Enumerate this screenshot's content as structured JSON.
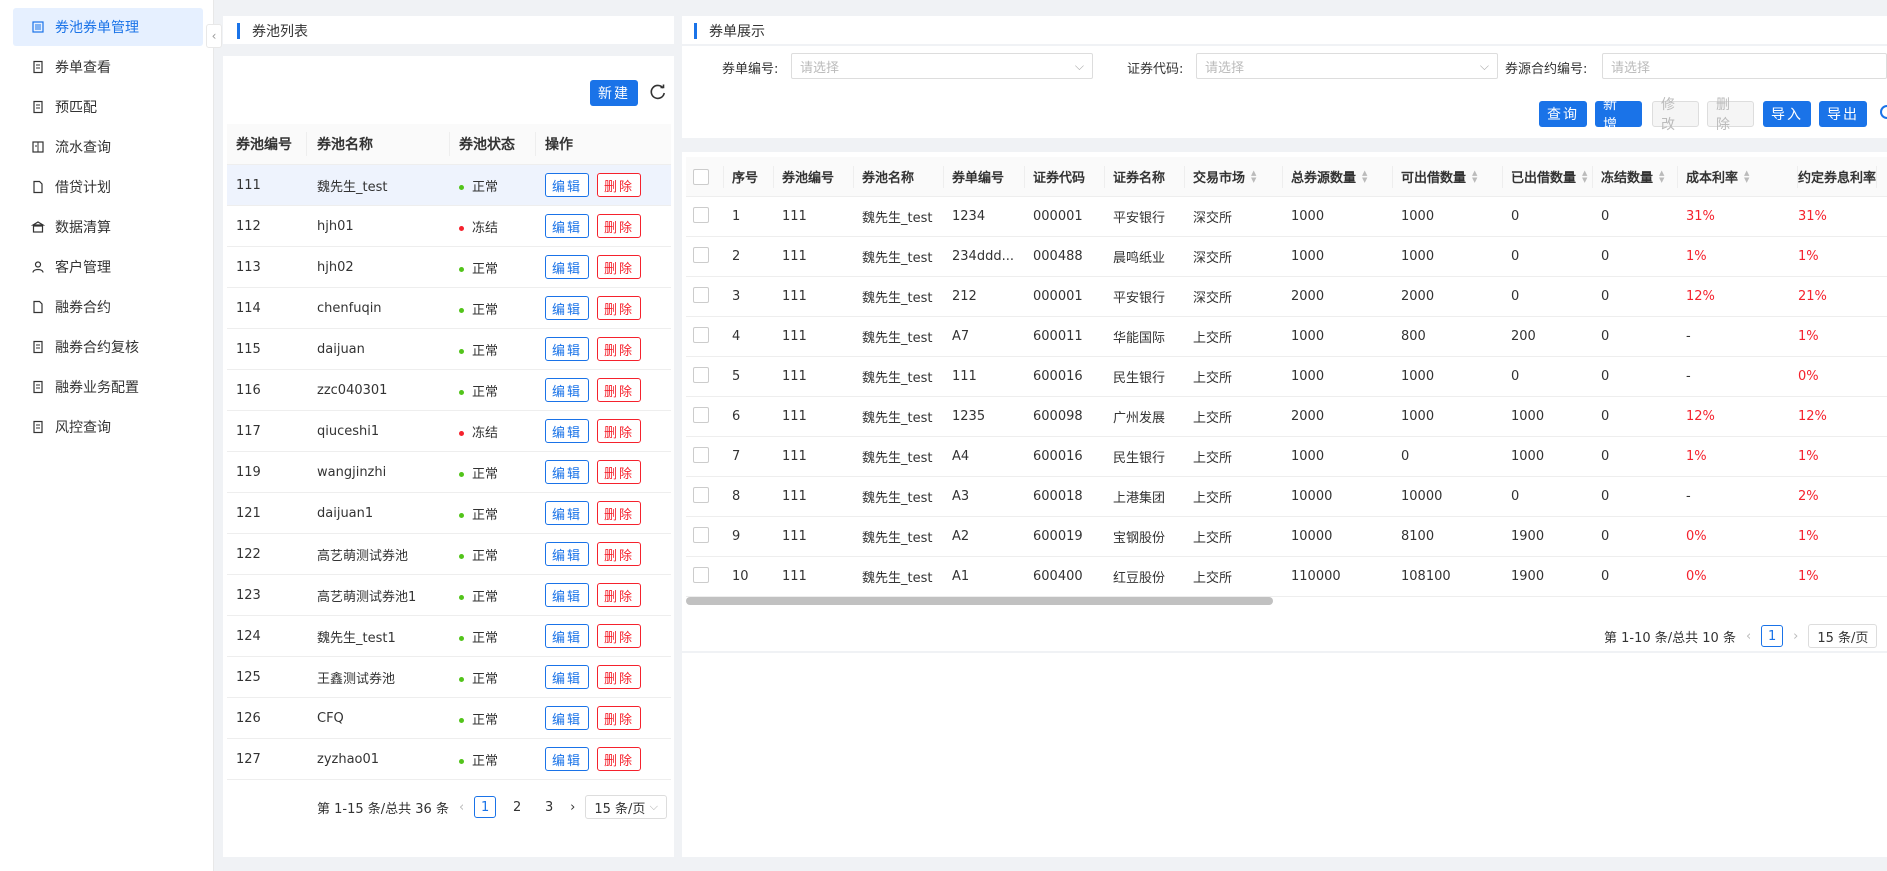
{
  "sidebar": {
    "items": [
      {
        "label": "券池券单管理",
        "icon": "list-icon",
        "active": true
      },
      {
        "label": "券单查看",
        "icon": "doc-icon"
      },
      {
        "label": "预匹配",
        "icon": "doc-icon"
      },
      {
        "label": "流水查询",
        "icon": "ledger-icon"
      },
      {
        "label": "借贷计划",
        "icon": "file-icon"
      },
      {
        "label": "数据清算",
        "icon": "bank-icon"
      },
      {
        "label": "客户管理",
        "icon": "user-icon"
      },
      {
        "label": "融券合约",
        "icon": "file-icon"
      },
      {
        "label": "融券合约复核",
        "icon": "doc-icon"
      },
      {
        "label": "融券业务配置",
        "icon": "doc-icon"
      },
      {
        "label": "风控查询",
        "icon": "doc-icon"
      }
    ]
  },
  "pool_panel": {
    "title": "券池列表",
    "new_button": "新建",
    "columns": [
      "券池编号",
      "券池名称",
      "券池状态",
      "操作"
    ],
    "edit_label": "编辑",
    "delete_label": "删除",
    "rows": [
      {
        "id": "111",
        "name": "魏先生_test",
        "status": "正常",
        "status_color": "#52c41a"
      },
      {
        "id": "112",
        "name": "hjh01",
        "status": "冻结",
        "status_color": "#f5222d"
      },
      {
        "id": "113",
        "name": "hjh02",
        "status": "正常",
        "status_color": "#52c41a"
      },
      {
        "id": "114",
        "name": "chenfuqin",
        "status": "正常",
        "status_color": "#52c41a"
      },
      {
        "id": "115",
        "name": "daijuan",
        "status": "正常",
        "status_color": "#52c41a"
      },
      {
        "id": "116",
        "name": "zzc040301",
        "status": "正常",
        "status_color": "#52c41a"
      },
      {
        "id": "117",
        "name": "qiuceshi1",
        "status": "冻结",
        "status_color": "#f5222d"
      },
      {
        "id": "119",
        "name": "wangjinzhi",
        "status": "正常",
        "status_color": "#52c41a"
      },
      {
        "id": "121",
        "name": "daijuan1",
        "status": "正常",
        "status_color": "#52c41a"
      },
      {
        "id": "122",
        "name": "高艺萌测试券池",
        "status": "正常",
        "status_color": "#52c41a"
      },
      {
        "id": "123",
        "name": "高艺萌测试券池1",
        "status": "正常",
        "status_color": "#52c41a"
      },
      {
        "id": "124",
        "name": "魏先生_test1",
        "status": "正常",
        "status_color": "#52c41a"
      },
      {
        "id": "125",
        "name": "王鑫测试券池",
        "status": "正常",
        "status_color": "#52c41a"
      },
      {
        "id": "126",
        "name": "CFQ",
        "status": "正常",
        "status_color": "#52c41a"
      },
      {
        "id": "127",
        "name": "zyzhao01",
        "status": "正常",
        "status_color": "#52c41a"
      }
    ],
    "pager": {
      "summary": "第 1-15 条/总共 36 条",
      "pages": [
        "1",
        "2",
        "3"
      ],
      "size": "15 条/页"
    }
  },
  "order_panel": {
    "title": "券单展示",
    "filters": [
      {
        "label": "券单编号:",
        "placeholder": "请选择"
      },
      {
        "label": "证券代码:",
        "placeholder": "请选择"
      },
      {
        "label": "券源合约编号:",
        "placeholder": "请选择"
      }
    ],
    "buttons": {
      "query": "查询",
      "add": "新增",
      "edit": "修改",
      "delete": "删除",
      "import": "导入",
      "export": "导出"
    },
    "columns": [
      "序号",
      "券池编号",
      "券池名称",
      "券单编号",
      "证券代码",
      "证券名称",
      "交易市场",
      "总券源数量",
      "可出借数量",
      "已出借数量",
      "冻结数量",
      "成本利率",
      "约定券息利率"
    ],
    "rows": [
      [
        "1",
        "111",
        "魏先生_test",
        "1234",
        "000001",
        "平安银行",
        "深交所",
        "1000",
        "1000",
        "0",
        "0",
        "31%",
        "31%"
      ],
      [
        "2",
        "111",
        "魏先生_test",
        "234ddd...",
        "000488",
        "晨鸣纸业",
        "深交所",
        "1000",
        "1000",
        "0",
        "0",
        "1%",
        "1%"
      ],
      [
        "3",
        "111",
        "魏先生_test",
        "212",
        "000001",
        "平安银行",
        "深交所",
        "2000",
        "2000",
        "0",
        "0",
        "12%",
        "21%"
      ],
      [
        "4",
        "111",
        "魏先生_test",
        "A7",
        "600011",
        "华能国际",
        "上交所",
        "1000",
        "800",
        "200",
        "0",
        "-",
        "1%"
      ],
      [
        "5",
        "111",
        "魏先生_test",
        "111",
        "600016",
        "民生银行",
        "上交所",
        "1000",
        "1000",
        "0",
        "0",
        "-",
        "0%"
      ],
      [
        "6",
        "111",
        "魏先生_test",
        "1235",
        "600098",
        "广州发展",
        "上交所",
        "2000",
        "1000",
        "1000",
        "0",
        "12%",
        "12%"
      ],
      [
        "7",
        "111",
        "魏先生_test",
        "A4",
        "600016",
        "民生银行",
        "上交所",
        "1000",
        "0",
        "1000",
        "0",
        "1%",
        "1%"
      ],
      [
        "8",
        "111",
        "魏先生_test",
        "A3",
        "600018",
        "上港集团",
        "上交所",
        "10000",
        "10000",
        "0",
        "0",
        "-",
        "2%"
      ],
      [
        "9",
        "111",
        "魏先生_test",
        "A2",
        "600019",
        "宝钢股份",
        "上交所",
        "10000",
        "8100",
        "1900",
        "0",
        "0%",
        "1%"
      ],
      [
        "10",
        "111",
        "魏先生_test",
        "A1",
        "600400",
        "红豆股份",
        "上交所",
        "110000",
        "108100",
        "1900",
        "0",
        "0%",
        "1%"
      ]
    ],
    "pager": {
      "summary": "第 1-10 条/总共 10 条",
      "pages": [
        "1"
      ],
      "size": "15 条/页"
    }
  }
}
